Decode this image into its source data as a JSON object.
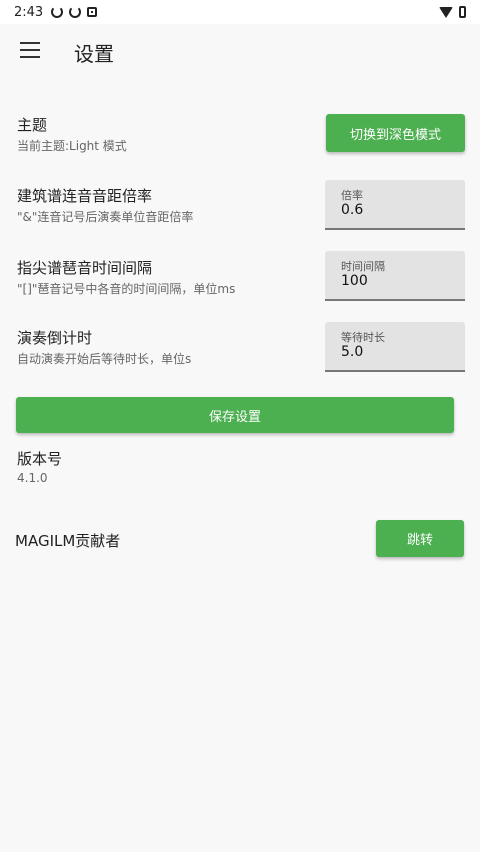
{
  "status_bar": {
    "time": "2:43",
    "icons_left": [
      "sync-icon",
      "sync-icon",
      "square-icon"
    ],
    "icons_right": [
      "wifi-icon",
      "battery-icon"
    ]
  },
  "header": {
    "menu_icon": "hamburger-menu-icon",
    "title": "设置"
  },
  "theme": {
    "title": "主题",
    "desc": "当前主题:Light 模式",
    "button_label": "切换到深色模式"
  },
  "spacing": {
    "title": "建筑谱连音音距倍率",
    "desc": "\"&\"连音记号后演奏单位音距倍率",
    "field_label": "倍率",
    "field_value": "0.6"
  },
  "interval": {
    "title": "指尖谱琶音时间间隔",
    "desc": "\"[]\"琶音记号中各音的时间间隔，单位ms",
    "field_label": "时间间隔",
    "field_value": "100"
  },
  "countdown": {
    "title": "演奏倒计时",
    "desc": "自动演奏开始后等待时长，单位s",
    "field_label": "等待时长",
    "field_value": "5.0"
  },
  "save": {
    "button_label": "保存设置"
  },
  "version": {
    "title": "版本号",
    "value": "4.1.0"
  },
  "contributors": {
    "title": "MAGILM贡献者",
    "button_label": "跳转"
  },
  "colors": {
    "accent": "#4caf50",
    "background": "#f8f8f8",
    "field_bg": "#e3e3e3"
  }
}
